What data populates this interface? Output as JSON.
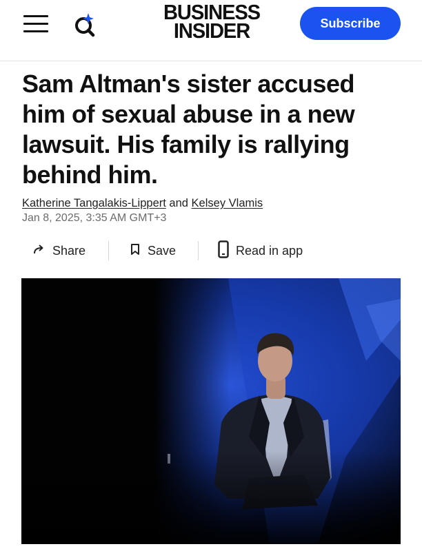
{
  "header": {
    "menu_icon": "hamburger-menu-icon",
    "search_icon": "search-sparkle-icon",
    "logo_line1": "BUSINESS",
    "logo_line2": "INSIDER",
    "subscribe_label": "Subscribe",
    "accent_color": "#1a53f0"
  },
  "article": {
    "headline": "Sam Altman's sister accused him of sexual abuse in a new lawsuit. His family is rallying behind him.",
    "author1": "Katherine Tangalakis-Lippert",
    "author_conjunction": "and",
    "author2": "Kelsey Vlamis",
    "date": "Jan 8, 2025, 3:35 AM GMT+3"
  },
  "actions": {
    "share_label": "Share",
    "save_label": "Save",
    "read_in_app_label": "Read in app",
    "share_icon": "share-arrow-icon",
    "save_icon": "bookmark-icon",
    "read_in_app_icon": "phone-icon"
  },
  "hero": {
    "image": "photo of a man in a dark blazer seated on stage against a blue-lit backdrop"
  }
}
